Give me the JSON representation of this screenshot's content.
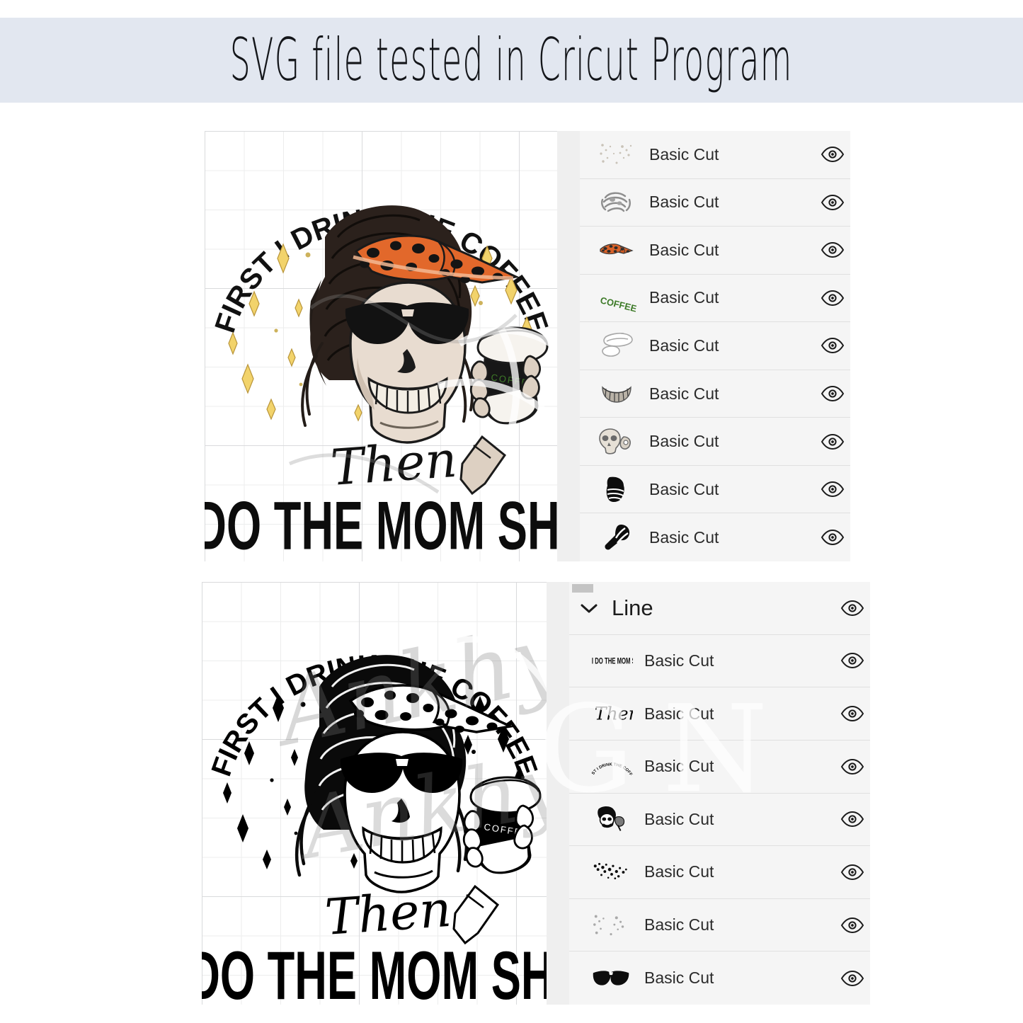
{
  "header": {
    "title": "SVG file tested in Cricut Program",
    "background_color": "#e2e7f0",
    "text_color": "#14161a"
  },
  "design": {
    "line_top": "FIRST I DRINK THE COFFEE",
    "line_script": "Then",
    "line_bottom": "I DO THE MOM SHIT",
    "cup_label": "COFFEE",
    "colors": {
      "bandana": "#e2682b",
      "bandana_spots": "#1a1a1a",
      "sparkle": "#f2d36b",
      "bone": "#e8dcd0",
      "hair": "#231c18",
      "coffee_text": "#3d7a28",
      "black": "#111111"
    }
  },
  "screenshots": [
    {
      "id": "cricut-color-version",
      "layer_rows": [
        {
          "label": "Basic Cut",
          "thumb": "sparkles-faint-icon",
          "eye": "visibility-eye-icon"
        },
        {
          "label": "Basic Cut",
          "thumb": "hair-strands-icon",
          "eye": "visibility-eye-icon"
        },
        {
          "label": "Basic Cut",
          "thumb": "leopard-bandana-icon",
          "eye": "visibility-eye-icon"
        },
        {
          "label": "Basic Cut",
          "thumb": "coffee-word-icon",
          "eye": "visibility-eye-icon"
        },
        {
          "label": "Basic Cut",
          "thumb": "cup-lid-icon",
          "eye": "visibility-eye-icon"
        },
        {
          "label": "Basic Cut",
          "thumb": "skull-teeth-icon",
          "eye": "visibility-eye-icon"
        },
        {
          "label": "Basic Cut",
          "thumb": "skull-jaw-icon",
          "eye": "visibility-eye-icon"
        },
        {
          "label": "Basic Cut",
          "thumb": "hair-bun-black-icon",
          "eye": "visibility-eye-icon"
        },
        {
          "label": "Basic Cut",
          "thumb": "hand-arm-black-icon",
          "eye": "visibility-eye-icon"
        }
      ]
    },
    {
      "id": "cricut-blackwhite-version",
      "group": {
        "label": "Line",
        "chevron": "chevron-down-icon",
        "eye": "visibility-eye-icon"
      },
      "layer_rows": [
        {
          "label": "Basic Cut",
          "thumb": "mom-shit-text-icon",
          "eye": "visibility-eye-icon"
        },
        {
          "label": "Basic Cut",
          "thumb": "then-script-icon",
          "eye": "visibility-eye-icon"
        },
        {
          "label": "Basic Cut",
          "thumb": "arched-coffee-text-icon",
          "eye": "visibility-eye-icon"
        },
        {
          "label": "Basic Cut",
          "thumb": "skull-full-icon",
          "eye": "visibility-eye-icon"
        },
        {
          "label": "Basic Cut",
          "thumb": "dots-dense-icon",
          "eye": "visibility-eye-icon"
        },
        {
          "label": "Basic Cut",
          "thumb": "dots-faint-icon",
          "eye": "visibility-eye-icon"
        },
        {
          "label": "Basic Cut",
          "thumb": "aviator-sunglasses-icon",
          "eye": "visibility-eye-icon"
        }
      ]
    }
  ],
  "watermark": {
    "script_text": "Ankhy Juh",
    "letters_text": "GN"
  }
}
